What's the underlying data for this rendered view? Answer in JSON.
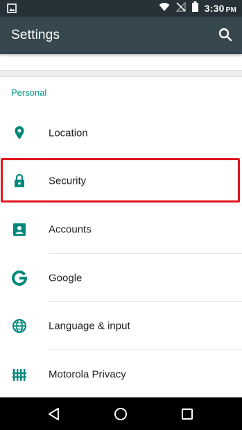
{
  "status_bar": {
    "time": "3:30",
    "ampm": "PM",
    "icons": [
      "image-notification-icon",
      "wifi-icon",
      "no-signal-icon",
      "battery-icon"
    ]
  },
  "app_bar": {
    "title": "Settings",
    "search_icon": "search-icon"
  },
  "section": {
    "header": "Personal",
    "accent_color": "#009688"
  },
  "items": [
    {
      "label": "Location",
      "icon": "location-pin-icon"
    },
    {
      "label": "Security",
      "icon": "lock-icon"
    },
    {
      "label": "Accounts",
      "icon": "account-box-icon"
    },
    {
      "label": "Google",
      "icon": "google-g-icon"
    },
    {
      "label": "Language & input",
      "icon": "globe-icon"
    },
    {
      "label": "Motorola Privacy",
      "icon": "motorola-privacy-icon"
    }
  ],
  "highlight_color": "#e0141e",
  "nav_bar": {
    "buttons": [
      "back-icon",
      "home-icon",
      "recents-icon"
    ]
  }
}
